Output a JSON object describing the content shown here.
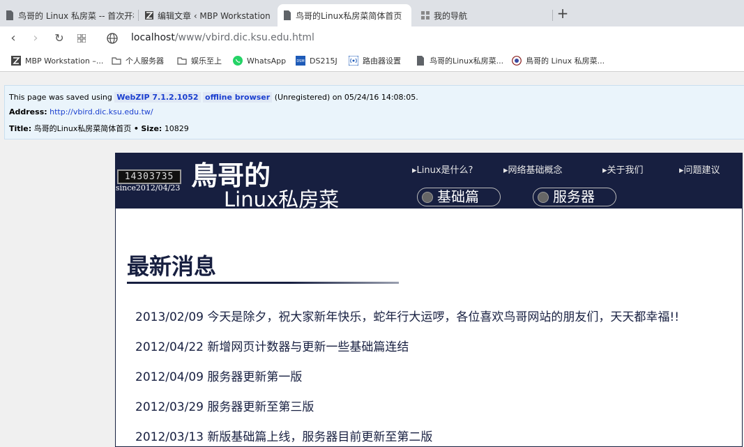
{
  "tabs": [
    {
      "label": "鸟哥的 Linux 私房菜 -- 首次开机"
    },
    {
      "label": "编辑文章 ‹ MBP Workstation —"
    },
    {
      "label": "鸟哥的Linux私房菜简体首页"
    },
    {
      "label": "我的导航"
    }
  ],
  "url": {
    "host": "localhost",
    "path": "/www/vbird.dic.ksu.edu.html"
  },
  "bookmarks": [
    {
      "label": "MBP Workstation –..."
    },
    {
      "label": "个人服务器"
    },
    {
      "label": "娱乐至上"
    },
    {
      "label": "WhatsApp"
    },
    {
      "label": "DS215J"
    },
    {
      "label": "路由器设置"
    },
    {
      "label": "鸟哥的Linux私房菜..."
    },
    {
      "label": "鳥哥的 Linux 私房菜..."
    }
  ],
  "saved": {
    "prefix": "This page was saved using",
    "webzip": "WebZIP 7.1.2.1052",
    "offline": "offline browser",
    "suffix": "(Unregistered) on 05/24/16 14:08:05.",
    "address_label": "Address:",
    "address": "http://vbird.dic.ksu.edu.tw/",
    "title_label": "Title:",
    "title": "鸟哥的Linux私房菜简体首页",
    "bullet": "•",
    "size_label": "Size:",
    "size": "10829"
  },
  "banner": {
    "counter": "14303735",
    "since": "since2012/04/23",
    "logo_line1": "鳥哥的",
    "logo_line2": "Linux私房菜",
    "nav": [
      "▸Linux是什么?",
      "▸网络基础概念",
      "▸关于我们",
      "▸问题建议"
    ],
    "pills": [
      "基础篇",
      "服务器"
    ]
  },
  "news": {
    "heading": "最新消息",
    "items": [
      "2013/02/09 今天是除夕，祝大家新年快乐，蛇年行大运啰，各位喜欢鸟哥网站的朋友们，天天都幸福!!",
      "2012/04/22 新增网页计数器与更新一些基础篇连结",
      "2012/04/09 服务器更新第一版",
      "2012/03/29 服务器更新至第三版",
      "2012/03/13 新版基础篇上线，服务器目前更新至第二版"
    ]
  }
}
